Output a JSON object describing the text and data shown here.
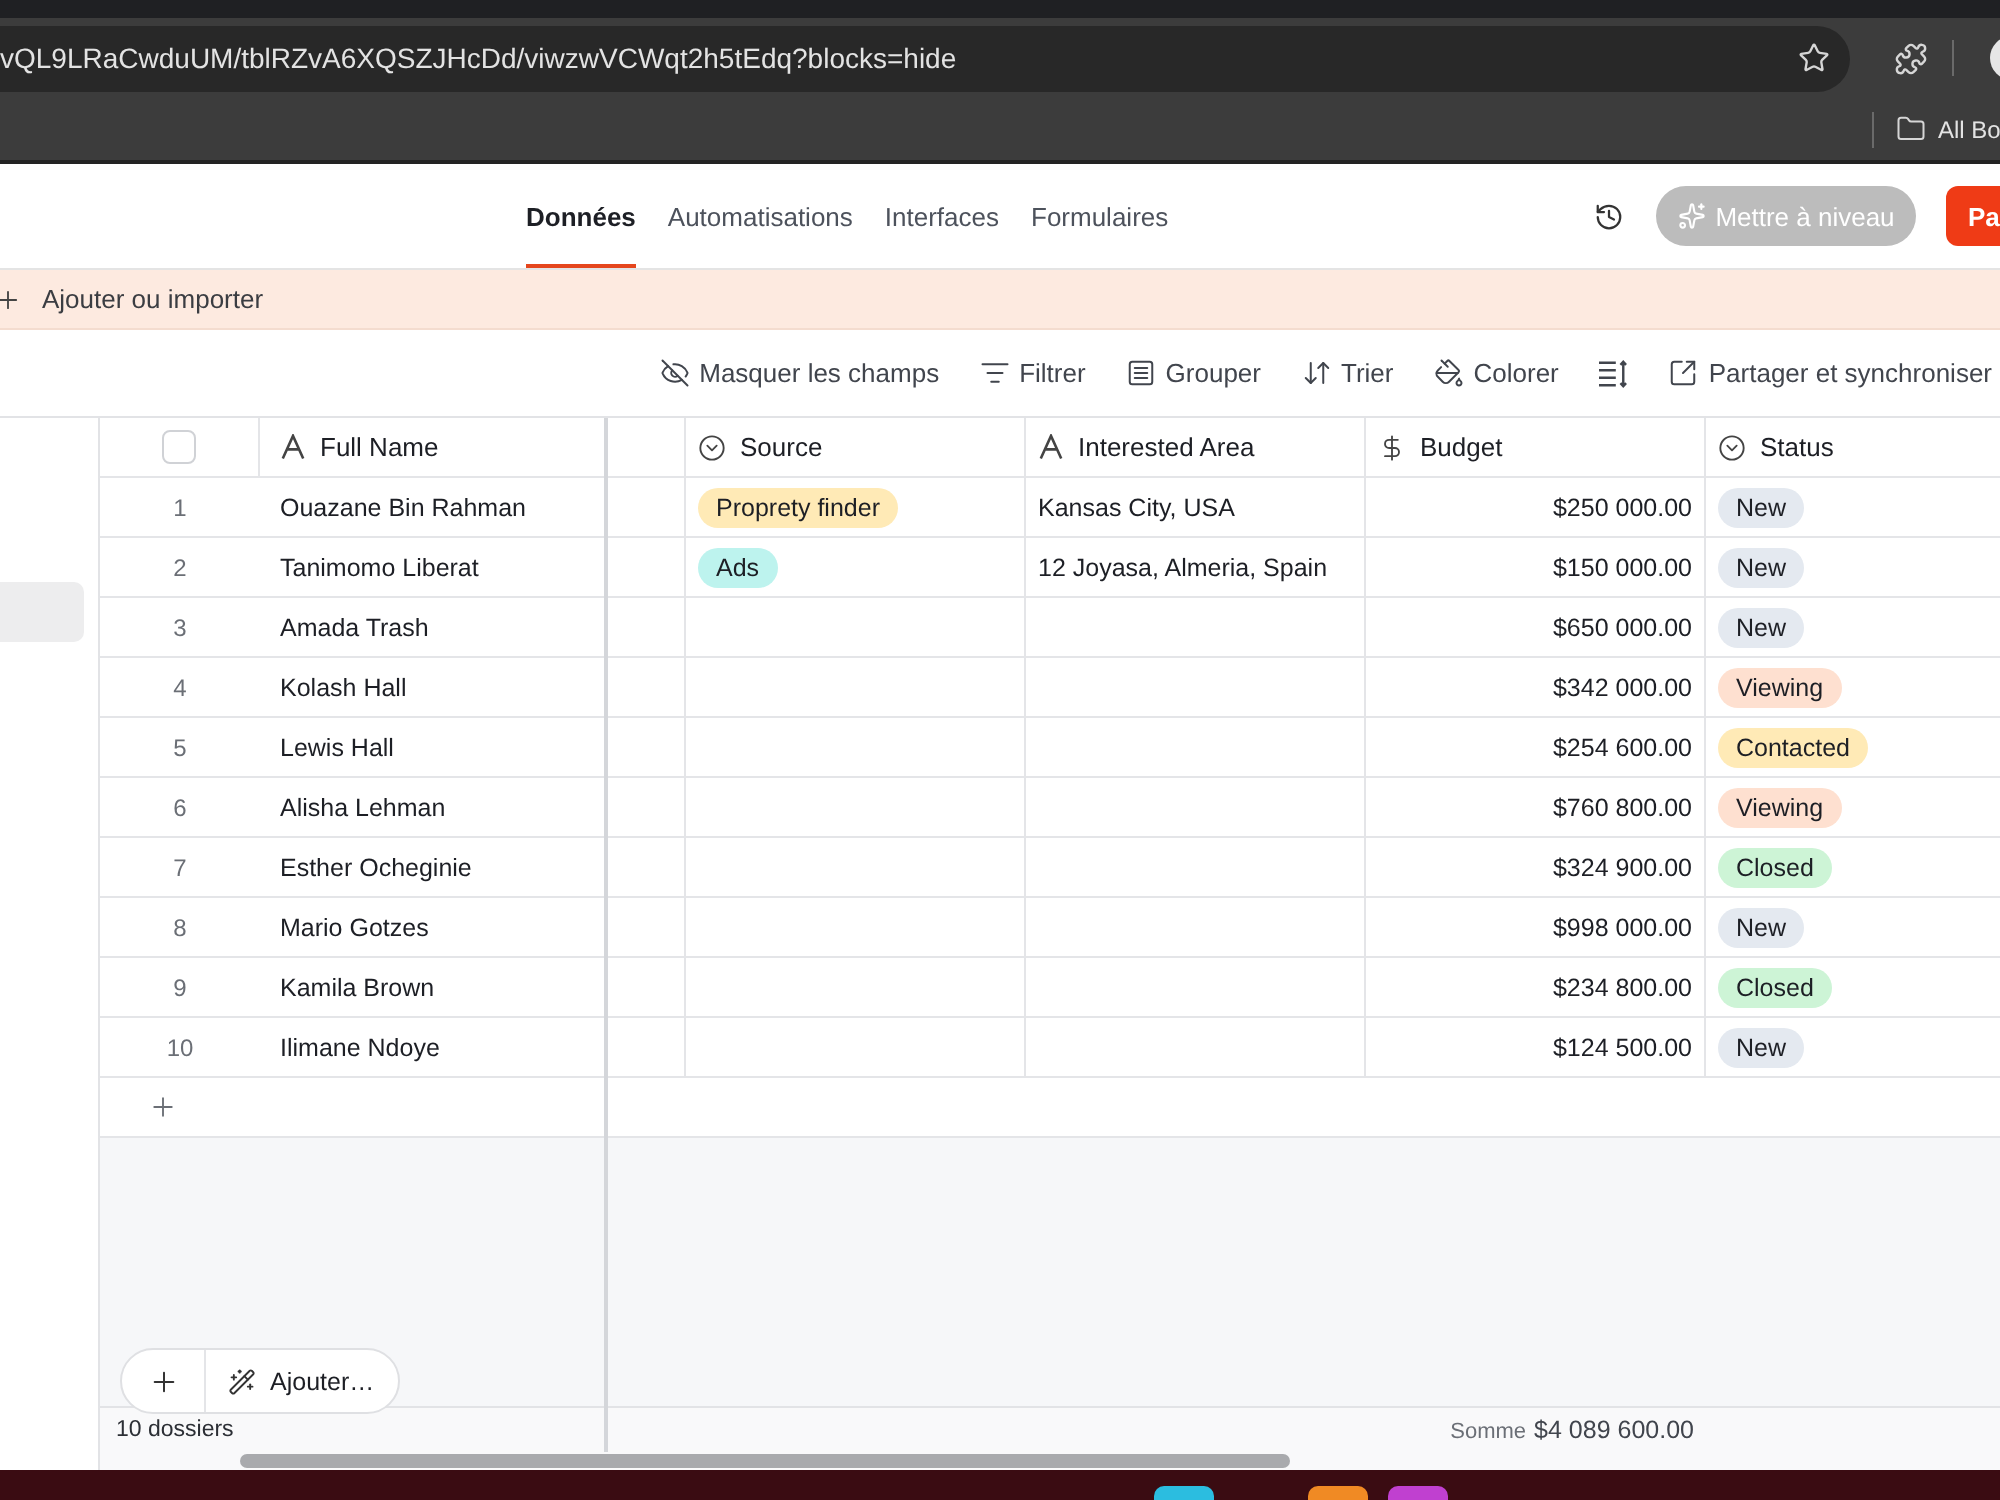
{
  "browser": {
    "url": "vQL9LRaCwduUM/tblRZvA6XQSZJHcDd/viwzwVCWqt2h5tEdq?blocks=hide",
    "bookmarks": [
      {
        "label": "All Bo"
      }
    ]
  },
  "app_tabs": [
    {
      "label": "Données",
      "selected": true
    },
    {
      "label": "Automatisations",
      "selected": false
    },
    {
      "label": "Interfaces",
      "selected": false
    },
    {
      "label": "Formulaires",
      "selected": false
    }
  ],
  "header_buttons": [
    {
      "kind": "upgrade",
      "label": "Mettre à niveau"
    },
    {
      "kind": "primary",
      "label": "Pa"
    }
  ],
  "banner": {
    "label": "Ajouter ou importer"
  },
  "toolbar": [
    {
      "kind": "hide_fields",
      "label": "Masquer les champs"
    },
    {
      "kind": "filter",
      "label": "Filtrer"
    },
    {
      "kind": "group",
      "label": "Grouper"
    },
    {
      "kind": "sort",
      "label": "Trier"
    },
    {
      "kind": "color",
      "label": "Colorer"
    },
    {
      "kind": "row_height"
    },
    {
      "kind": "share",
      "label": "Partager et synchroniser"
    }
  ],
  "sidebar": {
    "items": [
      {
        "selected": true
      }
    ]
  },
  "table": {
    "select_all": {
      "checked": false
    },
    "columns": [
      {
        "kind": "text",
        "label": "Full Name"
      },
      {
        "kind": "partial"
      },
      {
        "kind": "select",
        "label": "Source"
      },
      {
        "kind": "text",
        "label": "Interested Area"
      },
      {
        "kind": "currency",
        "label": "Budget"
      },
      {
        "kind": "select",
        "label": "Status"
      }
    ],
    "rows": [
      {
        "number": "1",
        "full_name": "Ouazane Bin Rahman",
        "source": {
          "label": "Proprety finder",
          "color": "#ffeab6"
        },
        "interested_area": "Kansas City, USA",
        "budget": "$250 000.00",
        "status": {
          "label": "New",
          "color": "#e4e9f0"
        }
      },
      {
        "number": "2",
        "full_name": "Tanimomo Liberat",
        "source": {
          "label": "Ads",
          "color": "#bdf3ee"
        },
        "interested_area": "12 Joyasa, Almeria, Spain",
        "budget": "$150 000.00",
        "status": {
          "label": "New",
          "color": "#e4e9f0"
        }
      },
      {
        "number": "3",
        "full_name": "Amada Trash",
        "budget": "$650 000.00",
        "status": {
          "label": "New",
          "color": "#e4e9f0"
        }
      },
      {
        "number": "4",
        "full_name": "Kolash Hall",
        "budget": "$342 000.00",
        "status": {
          "label": "Viewing",
          "color": "#fee0d0"
        }
      },
      {
        "number": "5",
        "full_name": "Lewis Hall",
        "budget": "$254 600.00",
        "status": {
          "label": "Contacted",
          "color": "#ffeab6"
        }
      },
      {
        "number": "6",
        "full_name": "Alisha Lehman",
        "budget": "$760 800.00",
        "status": {
          "label": "Viewing",
          "color": "#fee0d0"
        }
      },
      {
        "number": "7",
        "full_name": "Esther Ocheginie",
        "budget": "$324 900.00",
        "status": {
          "label": "Closed",
          "color": "#cdf4d6"
        }
      },
      {
        "number": "8",
        "full_name": "Mario Gotzes",
        "budget": "$998 000.00",
        "status": {
          "label": "New",
          "color": "#e4e9f0"
        }
      },
      {
        "number": "9",
        "full_name": "Kamila Brown",
        "budget": "$234 800.00",
        "status": {
          "label": "Closed",
          "color": "#cdf4d6"
        }
      },
      {
        "number": "10",
        "full_name": "Ilimane Ndoye",
        "budget": "$124 500.00",
        "status": {
          "label": "New",
          "color": "#e4e9f0"
        }
      }
    ],
    "footer": {
      "record_count": "10 dossiers",
      "sum_label": "Somme",
      "sum_value": "$4 089 600.00"
    },
    "add_menu": {
      "label": "Ajouter…"
    }
  },
  "dock": {
    "apps": [
      {
        "color": "#2bbde0"
      },
      {
        "color": "#f08a24"
      },
      {
        "color": "#c040d0"
      }
    ]
  }
}
